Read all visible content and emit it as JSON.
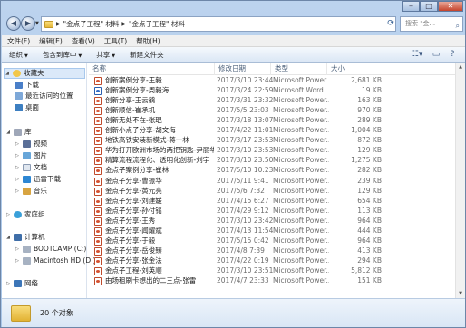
{
  "address": {
    "crumbs": [
      "\"金点子工程\" 材料",
      "\"金点子工程\" 材料"
    ],
    "search_placeholder": "搜索 \"金..."
  },
  "menu": [
    "文件(F)",
    "编辑(E)",
    "查看(V)",
    "工具(T)",
    "帮助(H)"
  ],
  "toolbar": {
    "organize": "组织",
    "include": "包含到库中",
    "share": "共享",
    "new_folder": "新建文件夹"
  },
  "sidebar": {
    "favorites": "收藏夹",
    "downloads": "下载",
    "recent": "最近访问的位置",
    "desktop": "桌面",
    "libraries": "库",
    "videos": "视频",
    "pictures": "图片",
    "documents": "文档",
    "thunder": "迅雷下载",
    "music": "音乐",
    "homegroup": "家庭组",
    "computer": "计算机",
    "bootcamp": "BOOTCAMP (C:)",
    "macintosh": "Macintosh HD (D:)",
    "network": "网络"
  },
  "columns": {
    "name": "名称",
    "date": "修改日期",
    "type": "类型",
    "size": "大小"
  },
  "files": [
    {
      "name": "创新案例分享-王毅",
      "date": "2017/3/10 23:44",
      "type": "Microsoft Power...",
      "size": "2,681 KB",
      "icon": "ppt"
    },
    {
      "name": "创新案例分享-周毅海",
      "date": "2017/3/24 22:59",
      "type": "Microsoft Word ...",
      "size": "19 KB",
      "icon": "word"
    },
    {
      "name": "创新分享-王云鹤",
      "date": "2017/3/31 23:32",
      "type": "Microsoft Power...",
      "size": "163 KB",
      "icon": "ppt"
    },
    {
      "name": "创新顺信-崔承机",
      "date": "2017/5/5 23:03",
      "type": "Microsoft Power...",
      "size": "970 KB",
      "icon": "ppt"
    },
    {
      "name": "创新无处不在-张琨",
      "date": "2017/3/18 13:07",
      "type": "Microsoft Power...",
      "size": "289 KB",
      "icon": "ppt"
    },
    {
      "name": "创新小点子分享-胡文海",
      "date": "2017/4/22 11:01",
      "type": "Microsoft Power...",
      "size": "1,004 KB",
      "icon": "ppt"
    },
    {
      "name": "地铁高铁安装新模式-蒋一林",
      "date": "2017/3/17 23:53",
      "type": "Microsoft Power...",
      "size": "872 KB",
      "icon": "ppt"
    },
    {
      "name": "华为打开欧洲市场的两把钥匙-尹丽华",
      "date": "2017/3/10 23:53",
      "type": "Microsoft Power...",
      "size": "129 KB",
      "icon": "ppt"
    },
    {
      "name": "精算流程流程化、透明化创新-刘宇",
      "date": "2017/3/10 23:50",
      "type": "Microsoft Power...",
      "size": "1,275 KB",
      "icon": "ppt"
    },
    {
      "name": "金点子案例分享-崔林",
      "date": "2017/5/10 10:23",
      "type": "Microsoft Power...",
      "size": "282 KB",
      "icon": "ppt"
    },
    {
      "name": "金点子分享-曹振华",
      "date": "2017/5/11 9:41",
      "type": "Microsoft Power...",
      "size": "239 KB",
      "icon": "ppt"
    },
    {
      "name": "金点子分享-黄元亮",
      "date": "2017/5/6 7:32",
      "type": "Microsoft Power...",
      "size": "129 KB",
      "icon": "ppt"
    },
    {
      "name": "金点子分享-刘建媛",
      "date": "2017/4/15 6:27",
      "type": "Microsoft Power...",
      "size": "654 KB",
      "icon": "ppt"
    },
    {
      "name": "金点子分享-孙付铭",
      "date": "2017/4/29 9:12",
      "type": "Microsoft Power...",
      "size": "113 KB",
      "icon": "ppt"
    },
    {
      "name": "金点子分享-王秀",
      "date": "2017/3/10 23:42",
      "type": "Microsoft Power...",
      "size": "964 KB",
      "icon": "ppt"
    },
    {
      "name": "金点子分享-闻耀斌",
      "date": "2017/4/13 11:54",
      "type": "Microsoft Power...",
      "size": "444 KB",
      "icon": "ppt"
    },
    {
      "name": "金点子分享-于毅",
      "date": "2017/5/15 0:42",
      "type": "Microsoft Power...",
      "size": "964 KB",
      "icon": "ppt"
    },
    {
      "name": "金点子分享-岳俊臻",
      "date": "2017/4/8 7:39",
      "type": "Microsoft Power...",
      "size": "413 KB",
      "icon": "ppt"
    },
    {
      "name": "金点子分享-张金法",
      "date": "2017/4/22 0:19",
      "type": "Microsoft Power...",
      "size": "294 KB",
      "icon": "ppt"
    },
    {
      "name": "金点子工程-刘英顺",
      "date": "2017/3/10 23:51",
      "type": "Microsoft Power...",
      "size": "5,812 KB",
      "icon": "ppt"
    },
    {
      "name": "由场租刷卡想出的二三点-张雷",
      "date": "2017/4/7 23:33",
      "type": "Microsoft Power...",
      "size": "151 KB",
      "icon": "ppt"
    }
  ],
  "status": {
    "count": "20 个对象"
  }
}
